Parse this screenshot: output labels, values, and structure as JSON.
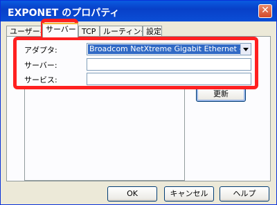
{
  "window": {
    "title": "EXPONET のプロパティ",
    "close_label": "✕"
  },
  "tabs": [
    {
      "label": "ユーザー名"
    },
    {
      "label": "サーバー"
    },
    {
      "label": "TCP"
    },
    {
      "label": "ルーティング"
    },
    {
      "label": "設定"
    }
  ],
  "active_tab": "サーバー",
  "form": {
    "adapter_label": "アダプタ:",
    "adapter_value": "Broadcom NetXtreme Gigabit Ethernet - パケット スケジューラ ミニポート",
    "server_label": "サーバー:",
    "server_value": "",
    "service_label": "サービス:",
    "service_value": "",
    "refresh_button": "更新"
  },
  "footer": {
    "ok": "OK",
    "cancel": "キャンセル",
    "help": "ヘルプ"
  },
  "colors": {
    "titlebar": "#0a4ed6",
    "highlight": "#ff2020",
    "selection": "#316ac5"
  }
}
